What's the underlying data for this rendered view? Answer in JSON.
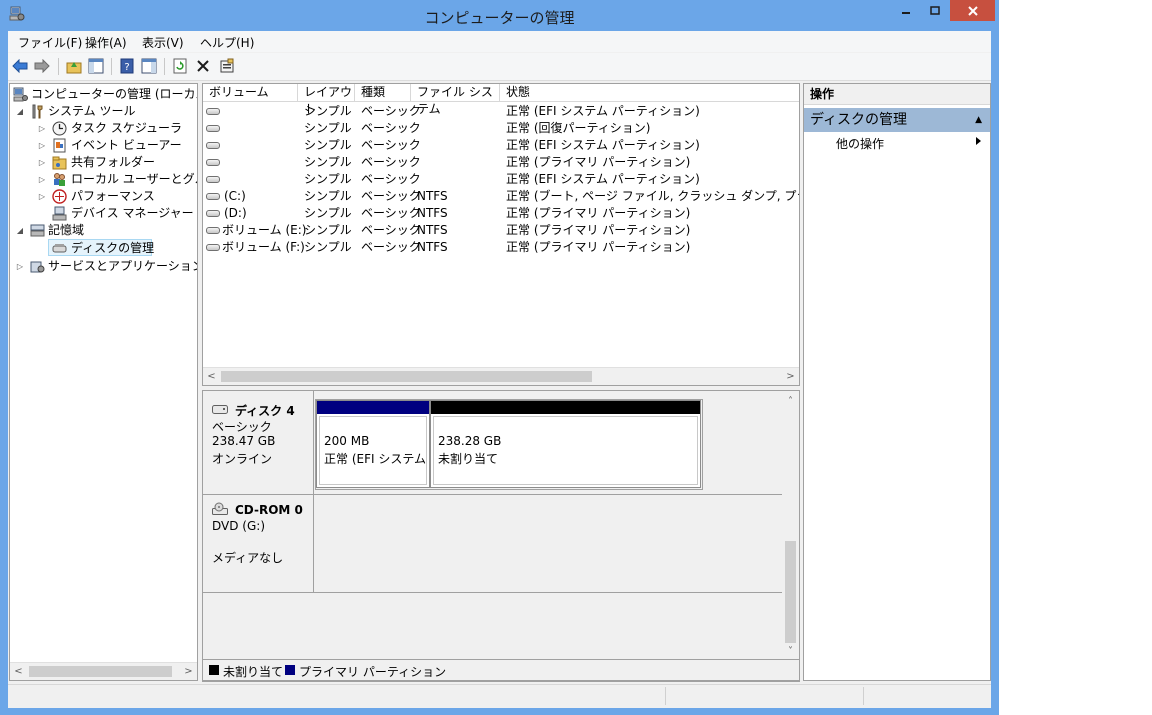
{
  "window": {
    "title": "コンピューターの管理",
    "accent": "#6ba6e8",
    "close_color": "#c7503f"
  },
  "menu": {
    "items": [
      {
        "label": "ファイル(F)"
      },
      {
        "label": "操作(A)"
      },
      {
        "label": "表示(V)"
      },
      {
        "label": "ヘルプ(H)"
      }
    ]
  },
  "toolbar": {
    "icons": [
      "back-arrow-icon",
      "forward-arrow-icon",
      "up-folder-icon",
      "show-tree-icon",
      "help-icon",
      "show-action-pane-icon",
      "refresh-icon",
      "delete-icon",
      "properties-icon"
    ]
  },
  "tree": {
    "root": "コンピューターの管理 (ローカル)",
    "system_tools": "システム ツール",
    "task_scheduler": "タスク スケジューラ",
    "event_viewer": "イベント ビューアー",
    "shared_folders": "共有フォルダー",
    "local_users": "ローカル ユーザーとグループ",
    "performance": "パフォーマンス",
    "device_manager": "デバイス マネージャー",
    "storage": "記憶域",
    "disk_management": "ディスクの管理",
    "services": "サービスとアプリケーション"
  },
  "volumes": {
    "columns": [
      "ボリューム",
      "レイアウト",
      "種類",
      "ファイル システム",
      "状態"
    ],
    "rows": [
      {
        "volume": "",
        "layout": "シンプル",
        "type": "ベーシック",
        "fs": "",
        "status": "正常 (EFI システム パーティション)"
      },
      {
        "volume": "",
        "layout": "シンプル",
        "type": "ベーシック",
        "fs": "",
        "status": "正常 (回復パーティション)"
      },
      {
        "volume": "",
        "layout": "シンプル",
        "type": "ベーシック",
        "fs": "",
        "status": "正常 (EFI システム パーティション)"
      },
      {
        "volume": "",
        "layout": "シンプル",
        "type": "ベーシック",
        "fs": "",
        "status": "正常 (プライマリ パーティション)"
      },
      {
        "volume": "",
        "layout": "シンプル",
        "type": "ベーシック",
        "fs": "",
        "status": "正常 (EFI システム パーティション)"
      },
      {
        "volume": "(C:)",
        "layout": "シンプル",
        "type": "ベーシック",
        "fs": "NTFS",
        "status": "正常 (ブート, ページ ファイル, クラッシュ ダンプ, プライマリ パーテ"
      },
      {
        "volume": "(D:)",
        "layout": "シンプル",
        "type": "ベーシック",
        "fs": "NTFS",
        "status": "正常 (プライマリ パーティション)"
      },
      {
        "volume": "ボリューム (E:)",
        "layout": "シンプル",
        "type": "ベーシック",
        "fs": "NTFS",
        "status": "正常 (プライマリ パーティション)"
      },
      {
        "volume": "ボリューム (F:)",
        "layout": "シンプル",
        "type": "ベーシック",
        "fs": "NTFS",
        "status": "正常 (プライマリ パーティション)"
      }
    ]
  },
  "disks": {
    "disk4": {
      "name": "ディスク 4",
      "type": "ベーシック",
      "size": "238.47 GB",
      "state": "オンライン",
      "partitions": [
        {
          "size": "200 MB",
          "status": "正常 (EFI システム .",
          "color": "#000080"
        },
        {
          "size": "238.28 GB",
          "status": "未割り当て",
          "color": "#000000"
        }
      ]
    },
    "cdrom0": {
      "name": "CD-ROM 0",
      "type": "DVD (G:)",
      "state": "メディアなし"
    }
  },
  "legend": {
    "unallocated": "未割り当て",
    "primary": "プライマリ パーティション",
    "unallocated_color": "#000000",
    "primary_color": "#000080"
  },
  "actions": {
    "title": "操作",
    "section": "ディスクの管理",
    "more": "他の操作"
  }
}
